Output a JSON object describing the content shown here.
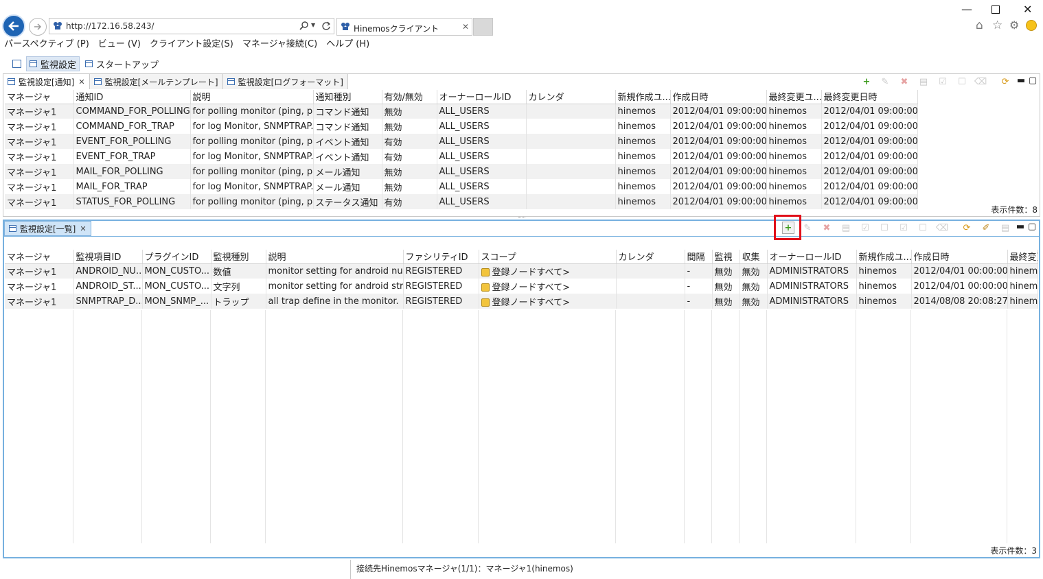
{
  "browser": {
    "url": "http://172.16.58.243/",
    "tab_title": "Hinemosクライアント"
  },
  "menu": [
    "パースペクティブ (P)",
    "ビュー (V)",
    "クライアント設定(S)",
    "マネージャ接続(C)",
    "ヘルプ (H)"
  ],
  "perspectives": [
    "監視設定",
    "スタートアップ"
  ],
  "top_panel": {
    "tabs": [
      "監視設定[通知]",
      "監視設定[メールテンプレート]",
      "監視設定[ログフォーマット]"
    ],
    "columns": [
      "マネージャ",
      "通知ID",
      "説明",
      "通知種別",
      "有効/無効",
      "オーナーロールID",
      "カレンダ",
      "新規作成ユ...",
      "作成日時",
      "最終変更ユ...",
      "最終変更日時"
    ],
    "rows": [
      [
        "マネージャ1",
        "COMMAND_FOR_POLLING",
        "for polling monitor (ping, p...",
        "コマンド通知",
        "無効",
        "ALL_USERS",
        "",
        "hinemos",
        "2012/04/01 09:00:00",
        "hinemos",
        "2012/04/01 09:00:00"
      ],
      [
        "マネージャ1",
        "COMMAND_FOR_TRAP",
        "for log Monitor, SNMPTRAP...",
        "コマンド通知",
        "無効",
        "ALL_USERS",
        "",
        "hinemos",
        "2012/04/01 09:00:00",
        "hinemos",
        "2012/04/01 09:00:00"
      ],
      [
        "マネージャ1",
        "EVENT_FOR_POLLING",
        "for polling monitor (ping, p...",
        "イベント通知",
        "有効",
        "ALL_USERS",
        "",
        "hinemos",
        "2012/04/01 09:00:00",
        "hinemos",
        "2012/04/01 09:00:00"
      ],
      [
        "マネージャ1",
        "EVENT_FOR_TRAP",
        "for log Monitor, SNMPTRAP...",
        "イベント通知",
        "有効",
        "ALL_USERS",
        "",
        "hinemos",
        "2012/04/01 09:00:00",
        "hinemos",
        "2012/04/01 09:00:00"
      ],
      [
        "マネージャ1",
        "MAIL_FOR_POLLING",
        "for polling monitor (ping, p...",
        "メール通知",
        "無効",
        "ALL_USERS",
        "",
        "hinemos",
        "2012/04/01 09:00:00",
        "hinemos",
        "2012/04/01 09:00:00"
      ],
      [
        "マネージャ1",
        "MAIL_FOR_TRAP",
        "for log Monitor, SNMPTRAP...",
        "メール通知",
        "無効",
        "ALL_USERS",
        "",
        "hinemos",
        "2012/04/01 09:00:00",
        "hinemos",
        "2012/04/01 09:00:00"
      ],
      [
        "マネージャ1",
        "STATUS_FOR_POLLING",
        "for polling monitor (ping, p...",
        "ステータス通知",
        "有効",
        "ALL_USERS",
        "",
        "hinemos",
        "2012/04/01 09:00:00",
        "hinemos",
        "2012/04/01 09:00:00"
      ]
    ],
    "count_label": "表示件数：8"
  },
  "bottom_panel": {
    "tab": "監視設定[一覧]",
    "columns": [
      "マネージャ",
      "監視項目ID",
      "プラグインID",
      "監視種別",
      "説明",
      "ファシリティID",
      "スコープ",
      "カレンダ",
      "間隔",
      "監視",
      "収集",
      "オーナーロールID",
      "新規作成ユ...",
      "作成日時",
      "最終変更"
    ],
    "rows": [
      [
        "マネージャ1",
        "ANDROID_NU...",
        "MON_CUSTO...",
        "数値",
        "monitor setting for android nu...",
        "REGISTERED",
        "登録ノードすべて>",
        "",
        "-",
        "無効",
        "無効",
        "ADMINISTRATORS",
        "hinemos",
        "2012/04/01 00:00:00",
        "hinemos"
      ],
      [
        "マネージャ1",
        "ANDROID_ST...",
        "MON_CUSTO...",
        "文字列",
        "monitor setting for android str...",
        "REGISTERED",
        "登録ノードすべて>",
        "",
        "-",
        "無効",
        "無効",
        "ADMINISTRATORS",
        "hinemos",
        "2012/04/01 00:00:00",
        "hinemos"
      ],
      [
        "マネージャ1",
        "SNMPTRAP_D...",
        "MON_SNMP_...",
        "トラップ",
        "all trap define in the monitor.",
        "REGISTERED",
        "登録ノードすべて>",
        "",
        "-",
        "無効",
        "無効",
        "ADMINISTRATORS",
        "hinemos",
        "2014/08/08 20:08:27",
        "hinemos"
      ]
    ],
    "count_label": "表示件数：3"
  },
  "status": "接続先Hinemosマネージャ(1/1)：マネージャ1(hinemos)",
  "colors": {
    "accent": "#1e64b4",
    "highlight": "#e0101a",
    "active_tab": "#cfe4f7"
  }
}
